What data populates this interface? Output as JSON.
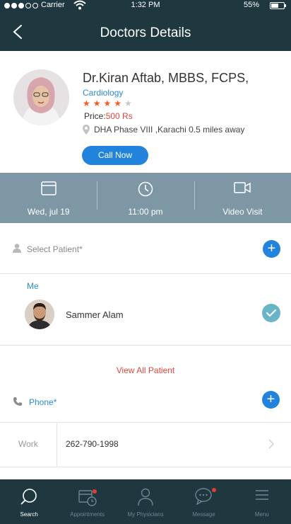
{
  "status_bar": {
    "carrier": "Carrier",
    "time": "1:32 PM",
    "battery": "55%"
  },
  "header": {
    "title": "Doctors Details"
  },
  "doctor": {
    "name": "Dr.Kiran Aftab, MBBS, FCPS,",
    "specialty": "Cardiology",
    "rating": 4,
    "rating_max": 5,
    "price_label": "Price:",
    "price_value": "500 Rs",
    "location": "DHA Phase VIII ,Karachi 0.5 miles away",
    "call_button": "Call Now"
  },
  "appointment": {
    "date": "Wed, jul 19",
    "time": "11:00 pm",
    "visit_type": "Video Visit"
  },
  "patient": {
    "select_label": "Select Patient*",
    "group_label": "Me",
    "name": "Sammer Alam",
    "view_all": "View All Patient"
  },
  "phone": {
    "label": "Phone*",
    "type": "Work",
    "number": "262-790-1998"
  },
  "tabbar": {
    "search": "Search",
    "appointments": "Appointments",
    "physicians": "My Physicians",
    "message": "Message",
    "menu": "Menu"
  },
  "colors": {
    "header_bg": "#1f3840",
    "accent_blue": "#2183dc",
    "band_bg": "#7e97a5",
    "price_red": "#e0463a",
    "star_orange": "#f25b2a",
    "check_teal": "#69b5c7"
  }
}
